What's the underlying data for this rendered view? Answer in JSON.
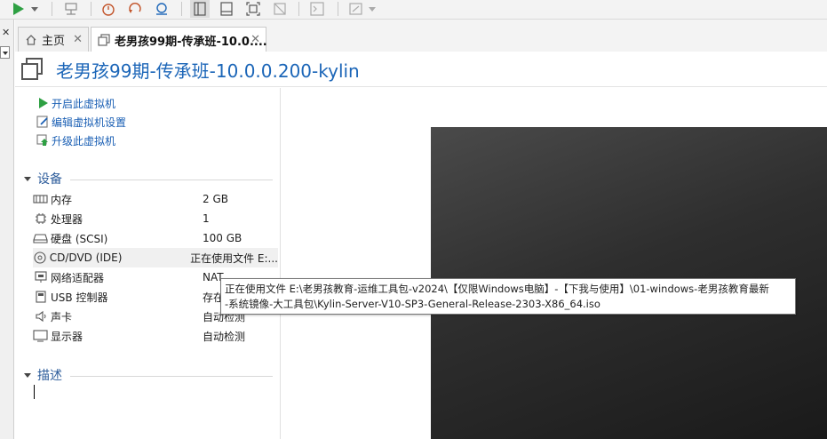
{
  "tabs": [
    {
      "label": "主页",
      "icon": "home-icon",
      "active": false
    },
    {
      "label": "老男孩99期-传承班-10.0....",
      "icon": "vm-tab-icon",
      "active": true
    }
  ],
  "header": {
    "title": "老男孩99期-传承班-10.0.0.200-kylin"
  },
  "actions": [
    {
      "label": "开启此虚拟机",
      "icon": "power-on-icon"
    },
    {
      "label": "编辑虚拟机设置",
      "icon": "edit-settings-icon"
    },
    {
      "label": "升级此虚拟机",
      "icon": "upgrade-icon"
    }
  ],
  "devices_section": {
    "title": "设备"
  },
  "devices": [
    {
      "name": "内存",
      "value": "2 GB",
      "icon": "memory-icon"
    },
    {
      "name": "处理器",
      "value": "1",
      "icon": "cpu-icon"
    },
    {
      "name": "硬盘 (SCSI)",
      "value": "100 GB",
      "icon": "hard-disk-icon"
    },
    {
      "name": "CD/DVD (IDE)",
      "value": "正在使用文件 E:...",
      "icon": "cd-dvd-icon"
    },
    {
      "name": "网络适配器",
      "value": "NAT",
      "icon": "network-adapter-icon"
    },
    {
      "name": "USB 控制器",
      "value": "存在",
      "icon": "usb-icon"
    },
    {
      "name": "声卡",
      "value": "自动检测",
      "icon": "speaker-icon"
    },
    {
      "name": "显示器",
      "value": "自动检测",
      "icon": "monitor-icon"
    }
  ],
  "description_section": {
    "title": "描述"
  },
  "tooltip": {
    "line1": "正在使用文件 E:\\老男孩教育-运维工具包-v2024\\【仅限Windows电脑】-【下我与使用】\\01-windows-老男孩教育最新",
    "line2": "-系统镜像-大工具包\\Kylin-Server-V10-SP3-General-Release-2303-X86_64.iso"
  },
  "colors": {
    "accent": "#1c66b8",
    "link": "#1a5fb4",
    "play": "#2ea043"
  }
}
